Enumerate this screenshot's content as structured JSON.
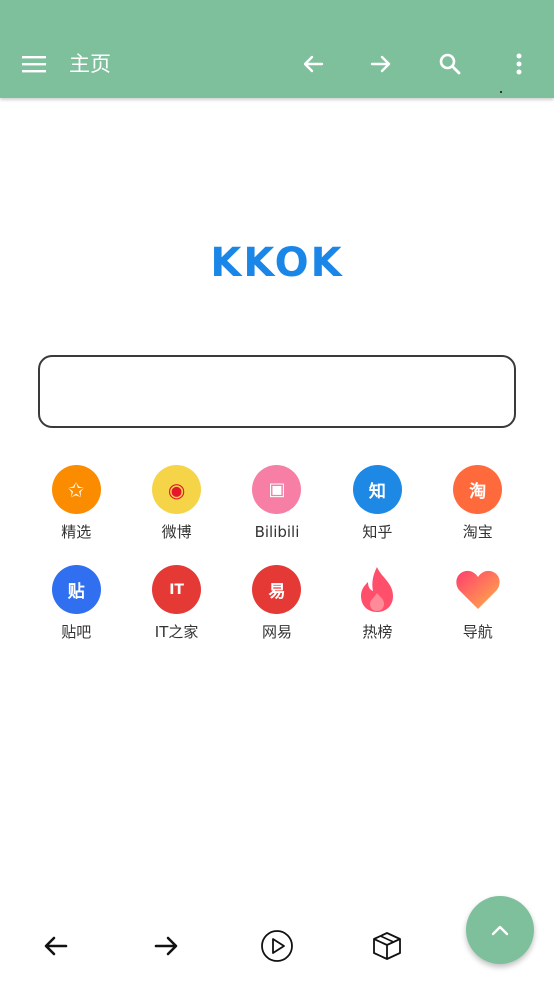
{
  "toolbar": {
    "title": "主页",
    "menu_icon": "menu-icon",
    "back_icon": "arrow-left-icon",
    "forward_icon": "arrow-right-icon",
    "search_icon": "search-icon",
    "more_icon": "more-vertical-icon",
    "bg_color": "#7ebf9c"
  },
  "logo": {
    "text": "KKOK",
    "color": "#1a86e8"
  },
  "search": {
    "value": "",
    "placeholder": ""
  },
  "shortcuts": [
    {
      "label": "精选",
      "icon": "star-icon",
      "glyph": "✩",
      "color": "#fb8c00"
    },
    {
      "label": "微博",
      "icon": "weibo-icon",
      "glyph": "◉",
      "color": "#f5d547"
    },
    {
      "label": "Bilibili",
      "icon": "bilibili-icon",
      "glyph": "▣",
      "color": "#f77fa5"
    },
    {
      "label": "知乎",
      "icon": "zhihu-icon",
      "glyph": "知",
      "color": "#1e88e5"
    },
    {
      "label": "淘宝",
      "icon": "taobao-icon",
      "glyph": "淘",
      "color": "#ff6a3d"
    },
    {
      "label": "贴吧",
      "icon": "tieba-icon",
      "glyph": "贴",
      "color": "#2f6ff0"
    },
    {
      "label": "IT之家",
      "icon": "ithome-icon",
      "glyph": "IT",
      "color": "#e53935"
    },
    {
      "label": "网易",
      "icon": "netease-icon",
      "glyph": "易",
      "color": "#e53935"
    },
    {
      "label": "热榜",
      "icon": "flame-icon",
      "glyph": "",
      "color": "#ff4f6a"
    },
    {
      "label": "导航",
      "icon": "heart-icon",
      "glyph": "",
      "color": "#ff5e62"
    }
  ],
  "bottom_bar": {
    "back_icon": "arrow-left-icon",
    "forward_icon": "arrow-right-icon",
    "play_icon": "play-circle-icon",
    "box_icon": "box-icon"
  },
  "fab": {
    "icon": "chevron-up-icon",
    "color": "#7ebf9c"
  }
}
